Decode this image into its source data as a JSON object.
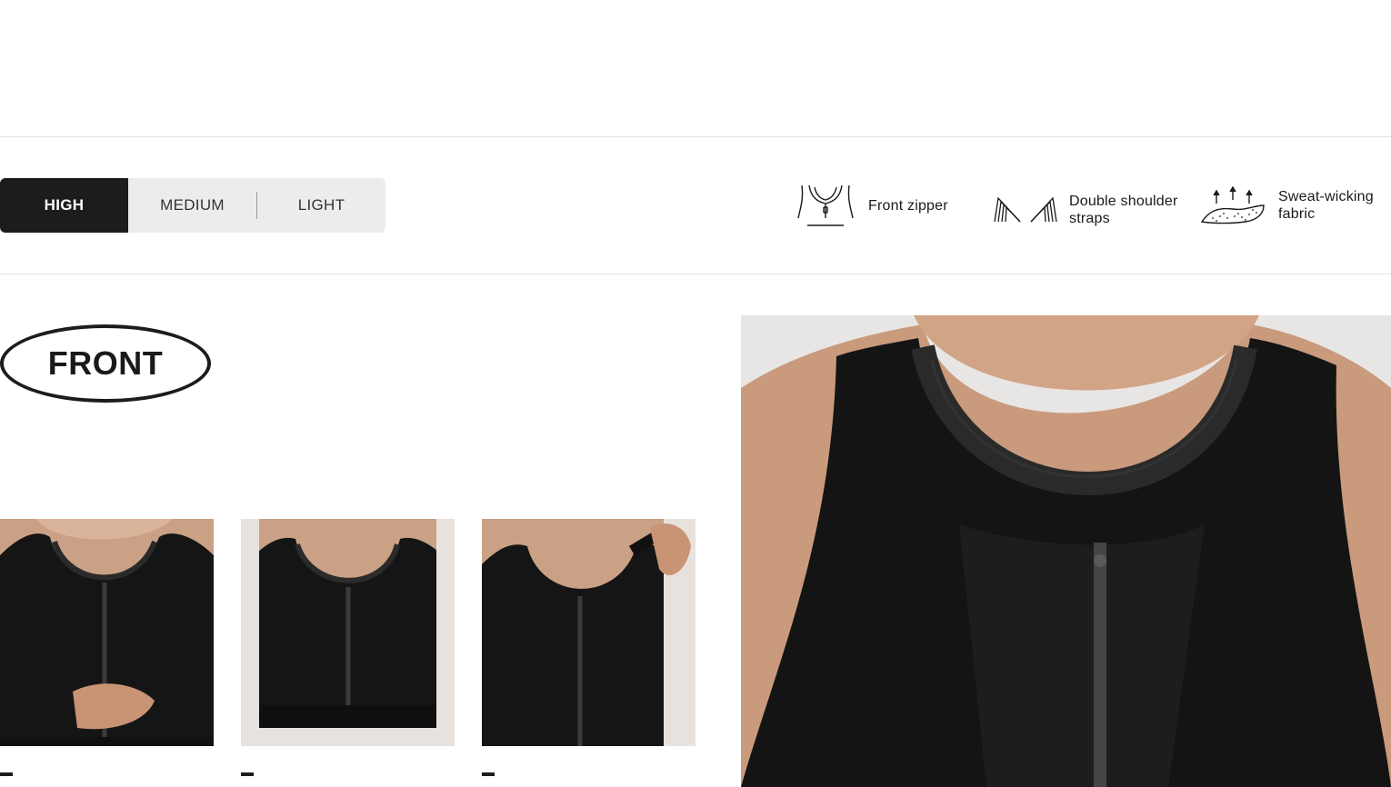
{
  "support_levels": {
    "tabs": [
      {
        "label": "HIGH",
        "active": true
      },
      {
        "label": "MEDIUM",
        "active": false
      },
      {
        "label": "LIGHT",
        "active": false
      }
    ]
  },
  "features": [
    {
      "icon": "front-zipper-icon",
      "label": "Front zipper"
    },
    {
      "icon": "double-straps-icon",
      "label_line1": "Double shoulder",
      "label_line2": "straps"
    },
    {
      "icon": "sweat-wicking-icon",
      "label_line1": "Sweat-wicking",
      "label_line2": "fabric"
    }
  ],
  "section": {
    "badge": "FRONT"
  },
  "thumbnails": [
    {
      "caption": "-",
      "alt": "zipping up the front of sports bra"
    },
    {
      "caption": "-",
      "alt": "sports bra front view"
    },
    {
      "caption": "-",
      "alt": "adjusting shoulder strap"
    }
  ],
  "colors": {
    "accent": "#1c1c1c",
    "tab_bg": "#ececec",
    "skin": "#c99a7c",
    "fabric": "#141414"
  }
}
